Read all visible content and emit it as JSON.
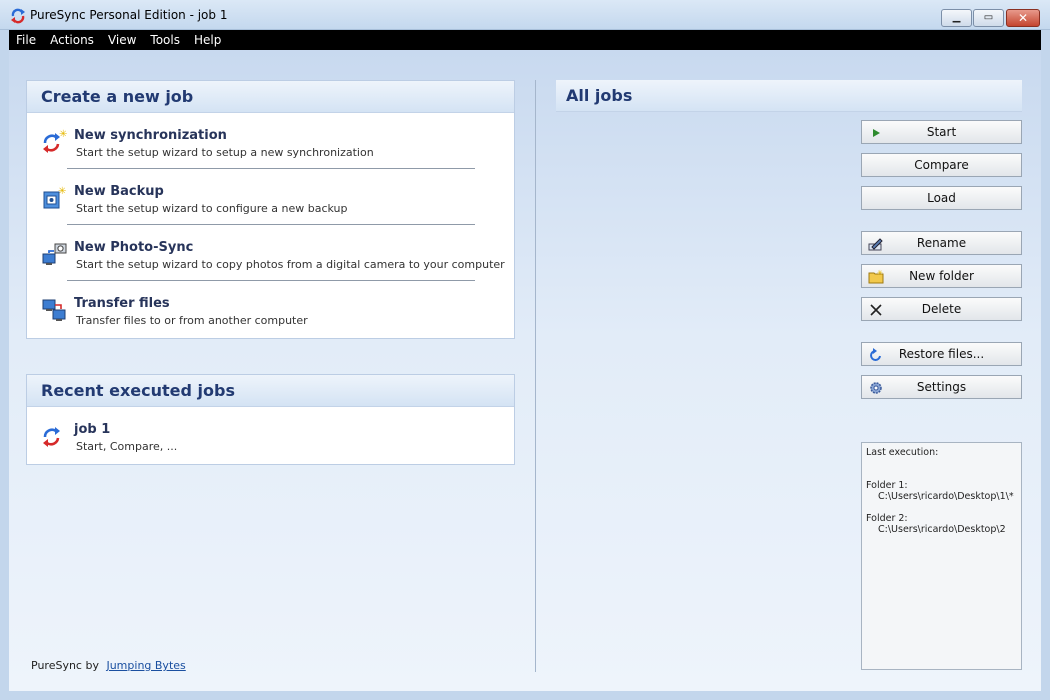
{
  "window": {
    "title": "PureSync Personal Edition  -  job 1",
    "controls": {
      "minimize": "minimize-icon",
      "maximize": "maximize-icon",
      "close": "close-icon"
    }
  },
  "menu": [
    "File",
    "Actions",
    "View",
    "Tools",
    "Help"
  ],
  "create_panel": {
    "title": "Create a new job",
    "items": [
      {
        "title": "New synchronization",
        "desc": "Start the setup wizard to setup a new synchronization",
        "icon": "sync-new-icon"
      },
      {
        "title": "New Backup",
        "desc": "Start the setup wizard to configure a new backup",
        "icon": "backup-new-icon"
      },
      {
        "title": "New Photo-Sync",
        "desc": "Start the setup wizard to copy photos from a digital camera to your computer",
        "icon": "photo-sync-icon"
      },
      {
        "title": "Transfer files",
        "desc": "Transfer files to or from another computer",
        "icon": "transfer-icon"
      }
    ]
  },
  "recent_panel": {
    "title": "Recent executed jobs",
    "items": [
      {
        "title": "job 1",
        "desc": "Start, Compare, ...",
        "icon": "sync-icon"
      }
    ]
  },
  "all_jobs": {
    "title": "All jobs",
    "buttons": {
      "start": "Start",
      "compare": "Compare",
      "load": "Load",
      "rename": "Rename",
      "new_folder": "New folder",
      "delete": "Delete",
      "restore": "Restore files...",
      "settings": "Settings"
    }
  },
  "info": {
    "last_execution": "Last execution:",
    "folder1_label": "Folder 1:",
    "folder1_path": "C:\\Users\\ricardo\\Desktop\\1\\*",
    "folder2_label": "Folder 2:",
    "folder2_path": "C:\\Users\\ricardo\\Desktop\\2"
  },
  "footer": {
    "prefix": "PureSync by",
    "link": "Jumping Bytes"
  },
  "colors": {
    "accent": "#223a72",
    "menubar": "#000000",
    "close": "#c4452f"
  }
}
